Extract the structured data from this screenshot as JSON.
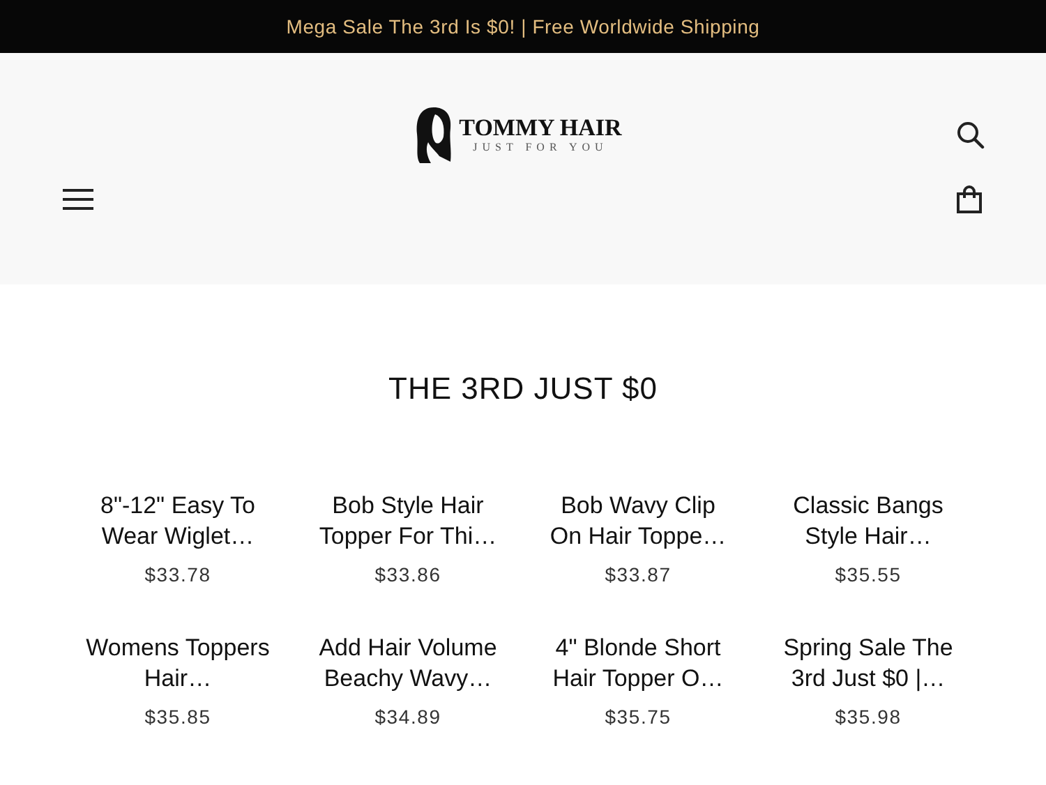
{
  "announcement": "Mega Sale The 3rd Is $0! | Free Worldwide Shipping",
  "logo": {
    "name": "TOMMY HAIR",
    "tagline": "JUST FOR YOU"
  },
  "section_title": "THE 3RD JUST $0",
  "products": [
    {
      "title": "8\"-12\" Easy To Wear Wiglet…",
      "price": "$33.78"
    },
    {
      "title": "Bob Style Hair Topper For Thi…",
      "price": "$33.86"
    },
    {
      "title": "Bob Wavy Clip On Hair Toppe…",
      "price": "$33.87"
    },
    {
      "title": "Classic Bangs Style Hair…",
      "price": "$35.55"
    },
    {
      "title": "Womens Toppers Hair…",
      "price": "$35.85"
    },
    {
      "title": "Add Hair Volume Beachy Wavy…",
      "price": "$34.89"
    },
    {
      "title": "4\" Blonde Short Hair Topper O…",
      "price": "$35.75"
    },
    {
      "title": "Spring Sale The 3rd Just $0 |…",
      "price": "$35.98"
    }
  ]
}
